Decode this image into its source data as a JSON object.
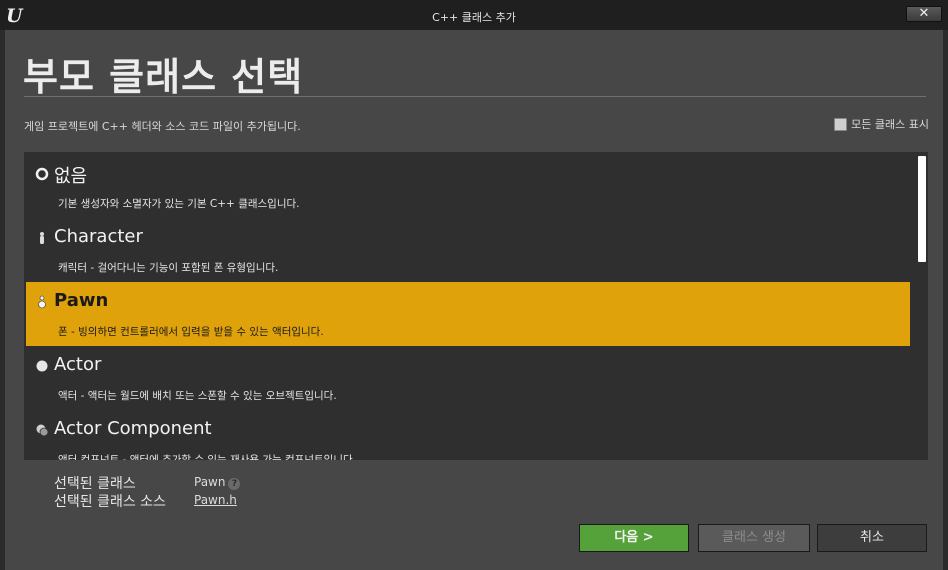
{
  "window": {
    "title": "C++ 클래스 추가",
    "close_label": "✕"
  },
  "page": {
    "heading": "부모 클래스 선택",
    "description": "게임 프로젝트에 C++ 헤더와 소스 코드 파일이 추가됩니다.",
    "show_all_label": "모든 클래스 표시",
    "show_all_checked": false
  },
  "classes": [
    {
      "name": "없음",
      "description": "기본 생성자와 소멸자가 있는 기본 C++ 클래스입니다.",
      "icon": "circle-outline-icon",
      "selected": false
    },
    {
      "name": "Character",
      "description": "캐릭터 - 걸어다니는 기능이 포함된 폰 유형입니다.",
      "icon": "character-icon",
      "selected": false
    },
    {
      "name": "Pawn",
      "description": "폰 - 빙의하면 컨트롤러에서 입력을 받을 수 있는 액터입니다.",
      "icon": "pawn-icon",
      "selected": true
    },
    {
      "name": "Actor",
      "description": "액터 - 액터는 월드에 배치 또는 스폰할 수 있는 오브젝트입니다.",
      "icon": "sphere-icon",
      "selected": false
    },
    {
      "name": "Actor Component",
      "description": "액터 컴포넌트 - 액터에 추가할 수 있는 재사용 가능 컴포넌트입니다.",
      "icon": "component-icon",
      "selected": false
    }
  ],
  "selection": {
    "class_label": "선택된 클래스",
    "class_value": "Pawn",
    "source_label": "선택된 클래스 소스",
    "source_value": "Pawn.h"
  },
  "buttons": {
    "next": "다음 >",
    "create": "클래스 생성",
    "cancel": "취소"
  },
  "colors": {
    "selected_row": "#e0a20a",
    "next_button": "#55a23a"
  }
}
